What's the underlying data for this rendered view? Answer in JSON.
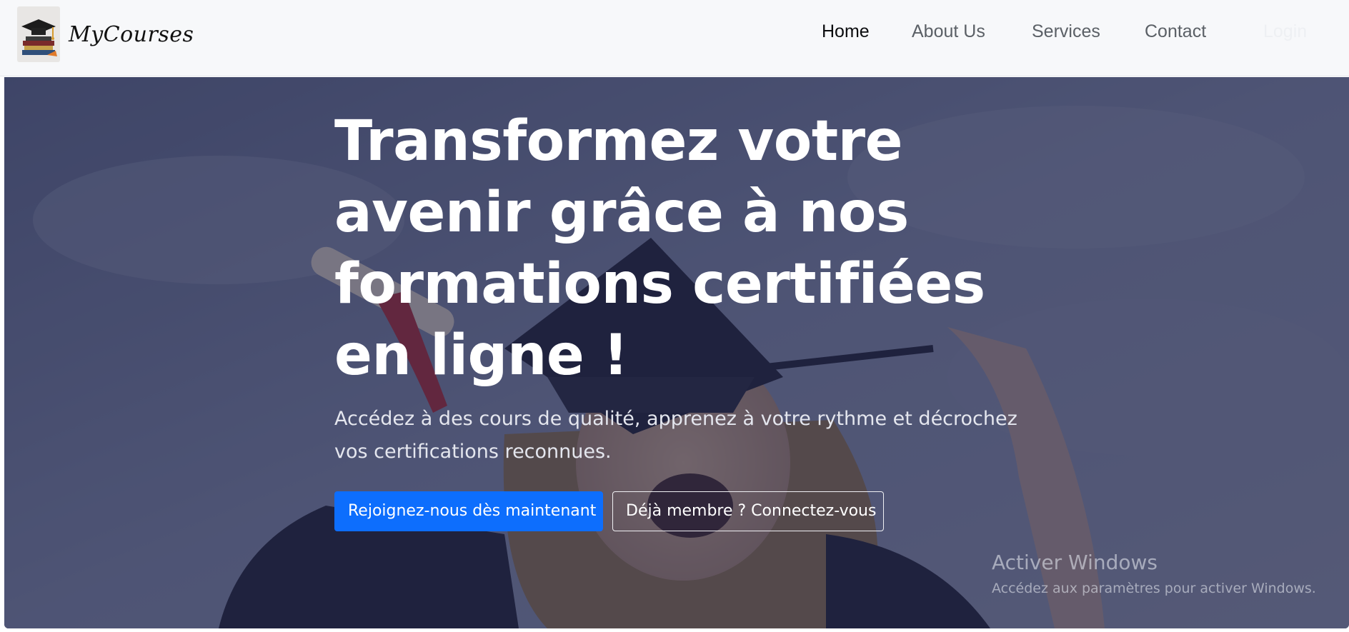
{
  "navbar": {
    "brand_name": "MyCourses",
    "links": [
      {
        "label": "Home",
        "active": true
      },
      {
        "label": "About Us",
        "active": false
      },
      {
        "label": "Services",
        "active": false
      },
      {
        "label": "Contact",
        "active": false
      },
      {
        "label": "Login",
        "active": false
      }
    ]
  },
  "hero": {
    "title": "Transformez votre avenir grâce à nos formations certifiées en ligne !",
    "subtitle": "Accédez à des cours de qualité, apprenez à votre rythme et décrochez vos certifications reconnues.",
    "primary_button": "Rejoignez-nous dès maintenant",
    "secondary_button": "Déjà membre ? Connectez-vous"
  },
  "watermark": {
    "title": "Activer Windows",
    "subtitle": "Accédez aux paramètres pour activer Windows."
  },
  "colors": {
    "primary": "#0d6efd",
    "overlay": "#2c3050",
    "navbar_bg": "#f7f8fa"
  }
}
